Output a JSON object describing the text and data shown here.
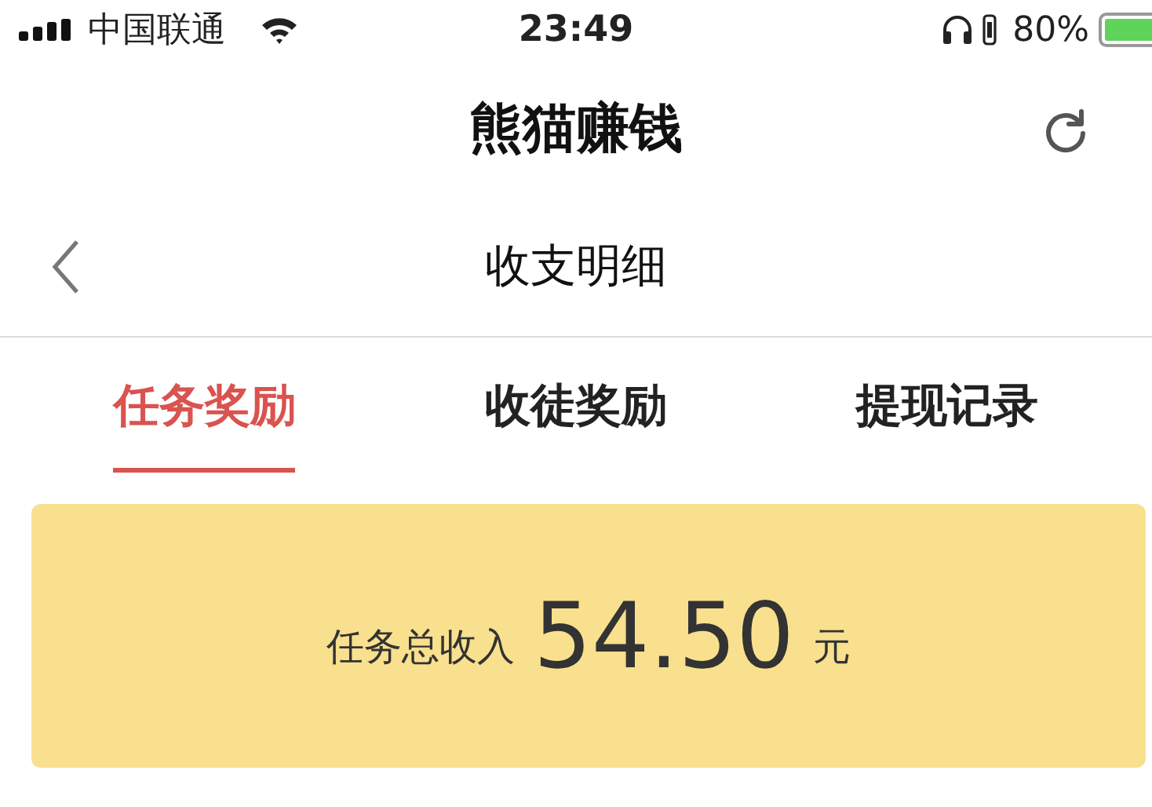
{
  "status_bar": {
    "carrier": "中国联通",
    "time": "23:49",
    "battery_percent": "80%"
  },
  "app_bar": {
    "title": "熊猫赚钱"
  },
  "nav_bar": {
    "title": "收支明细"
  },
  "tabs": [
    {
      "label": "任务奖励",
      "selected": true
    },
    {
      "label": "收徒奖励",
      "selected": false
    },
    {
      "label": "提现记录",
      "selected": false
    }
  ],
  "summary": {
    "label": "任务总收入",
    "amount": "54.50",
    "unit": "元"
  }
}
